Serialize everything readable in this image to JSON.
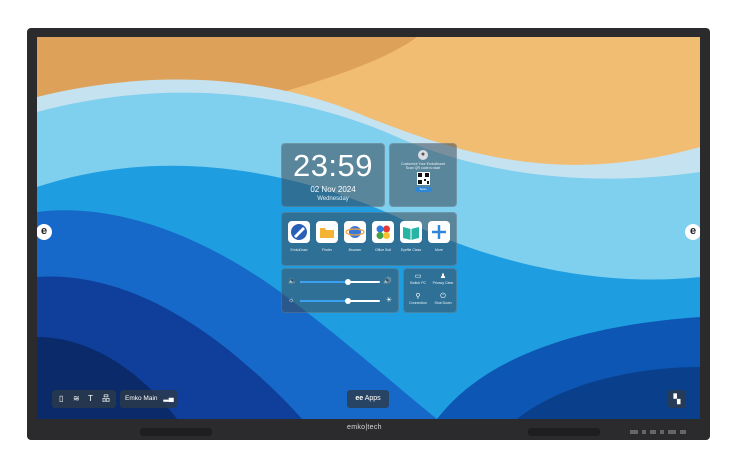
{
  "clock": {
    "time": "23:59",
    "date": "02 Nov 2024",
    "day": "Wednesday"
  },
  "qr_card": {
    "line1": "Customize Your EmkoBoard",
    "line2": "Scan QR code to start",
    "button": "Scan"
  },
  "apps": [
    {
      "label": "EmkoDraw",
      "icon": "pen-drawing-icon"
    },
    {
      "label": "Finder",
      "icon": "folder-icon"
    },
    {
      "label": "Browser",
      "icon": "planet-browser-icon"
    },
    {
      "label": "Office Suit",
      "icon": "office-suite-icon"
    },
    {
      "label": "Eyefile Class",
      "icon": "book-icon"
    },
    {
      "label": "More",
      "icon": "plus-icon"
    }
  ],
  "sliders": [
    {
      "name": "volume",
      "icon": "speaker-icon",
      "level": 0.6
    },
    {
      "name": "brightness",
      "icon": "sun-icon",
      "level": 0.6
    }
  ],
  "quick_actions": [
    {
      "label": "Switch PC",
      "icon": "monitor-icon"
    },
    {
      "label": "Privacy Clear",
      "icon": "broom-icon"
    },
    {
      "label": "Connection",
      "icon": "usb-icon"
    },
    {
      "label": "Shut Down",
      "icon": "power-icon"
    }
  ],
  "status_icons": [
    "mouse-icon",
    "wifi-icon",
    "antenna-icon",
    "lan-icon"
  ],
  "network": {
    "name": "Emko Main",
    "icon": "signal-icon"
  },
  "apps_button": "Apps",
  "brand": "emko|tech",
  "colors": {
    "accent": "#2f86d6",
    "panel": "#3c4b5a",
    "bezel": "#2b2b2d"
  }
}
